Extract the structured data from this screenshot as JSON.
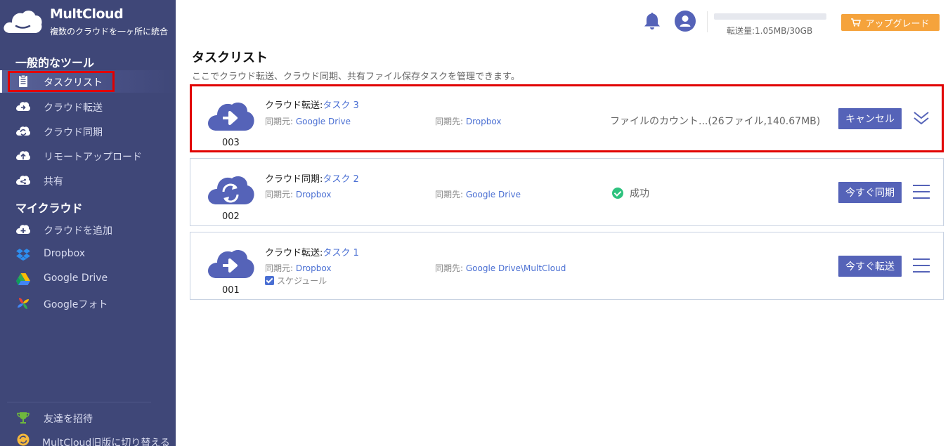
{
  "brand": {
    "name": "MultCloud",
    "tagline": "複数のクラウドを一ヶ所に統合"
  },
  "sidebar": {
    "general_title": "一般的なツール",
    "general_items": [
      {
        "label": "タスクリスト",
        "icon": "clipboard-list-icon",
        "active": true
      },
      {
        "label": "クラウド転送",
        "icon": "cloud-transfer-icon"
      },
      {
        "label": "クラウド同期",
        "icon": "cloud-sync-icon"
      },
      {
        "label": "リモートアップロード",
        "icon": "cloud-upload-icon"
      },
      {
        "label": "共有",
        "icon": "cloud-share-icon"
      }
    ],
    "mycloud_title": "マイクラウド",
    "mycloud_items": [
      {
        "label": "クラウドを追加",
        "icon": "cloud-add-icon"
      },
      {
        "label": "Dropbox",
        "icon": "dropbox-icon"
      },
      {
        "label": "Google Drive",
        "icon": "google-drive-icon"
      },
      {
        "label": "Googleフォト",
        "icon": "google-photos-icon"
      }
    ],
    "footer_items": [
      {
        "label": "友達を招待",
        "icon": "trophy-icon"
      },
      {
        "label": "MultCloud旧版に切り替える",
        "icon": "switch-version-icon"
      }
    ]
  },
  "header": {
    "quota_text": "転送量:1.05MB/30GB",
    "quota_used_fraction": 4e-05,
    "upgrade_label": "アップグレード"
  },
  "main": {
    "title": "タスクリスト",
    "subtitle": "ここでクラウド転送、クラウド同期、共有ファイル保存タスクを管理できます。",
    "tasks": [
      {
        "num": "003",
        "type_label": "クラウド転送:",
        "name": "タスク 3",
        "icon": "cloud-transfer-icon",
        "src_label": "同期元:",
        "src": "Google Drive",
        "dst_label": "同期先:",
        "dst": "Dropbox",
        "status": "ファイルのカウント...(26ファイル,140.67MB)",
        "action": "キャンセル",
        "menu_icon": "chevron-double-down-icon"
      },
      {
        "num": "002",
        "type_label": "クラウド同期:",
        "name": "タスク 2",
        "icon": "cloud-sync-icon",
        "src_label": "同期元:",
        "src": "Dropbox",
        "dst_label": "同期先:",
        "dst": "Google Drive",
        "status": "成功",
        "action": "今すぐ同期",
        "menu_icon": "hamburger-menu-icon"
      },
      {
        "num": "001",
        "type_label": "クラウド転送:",
        "name": "タスク 1",
        "icon": "cloud-transfer-icon",
        "src_label": "同期元:",
        "src": "Dropbox",
        "dst_label": "同期先:",
        "dst": "Google Drive\\MultCloud",
        "schedule_label": "スケジュール",
        "schedule_checked": true,
        "action": "今すぐ転送",
        "menu_icon": "hamburger-menu-icon"
      }
    ]
  },
  "colors": {
    "sidebar_bg": "#3f4778",
    "accent": "#5563b8",
    "link": "#4a6fd3",
    "upgrade": "#f5a33c",
    "highlight": "#e10000",
    "success": "#2ec27e"
  }
}
